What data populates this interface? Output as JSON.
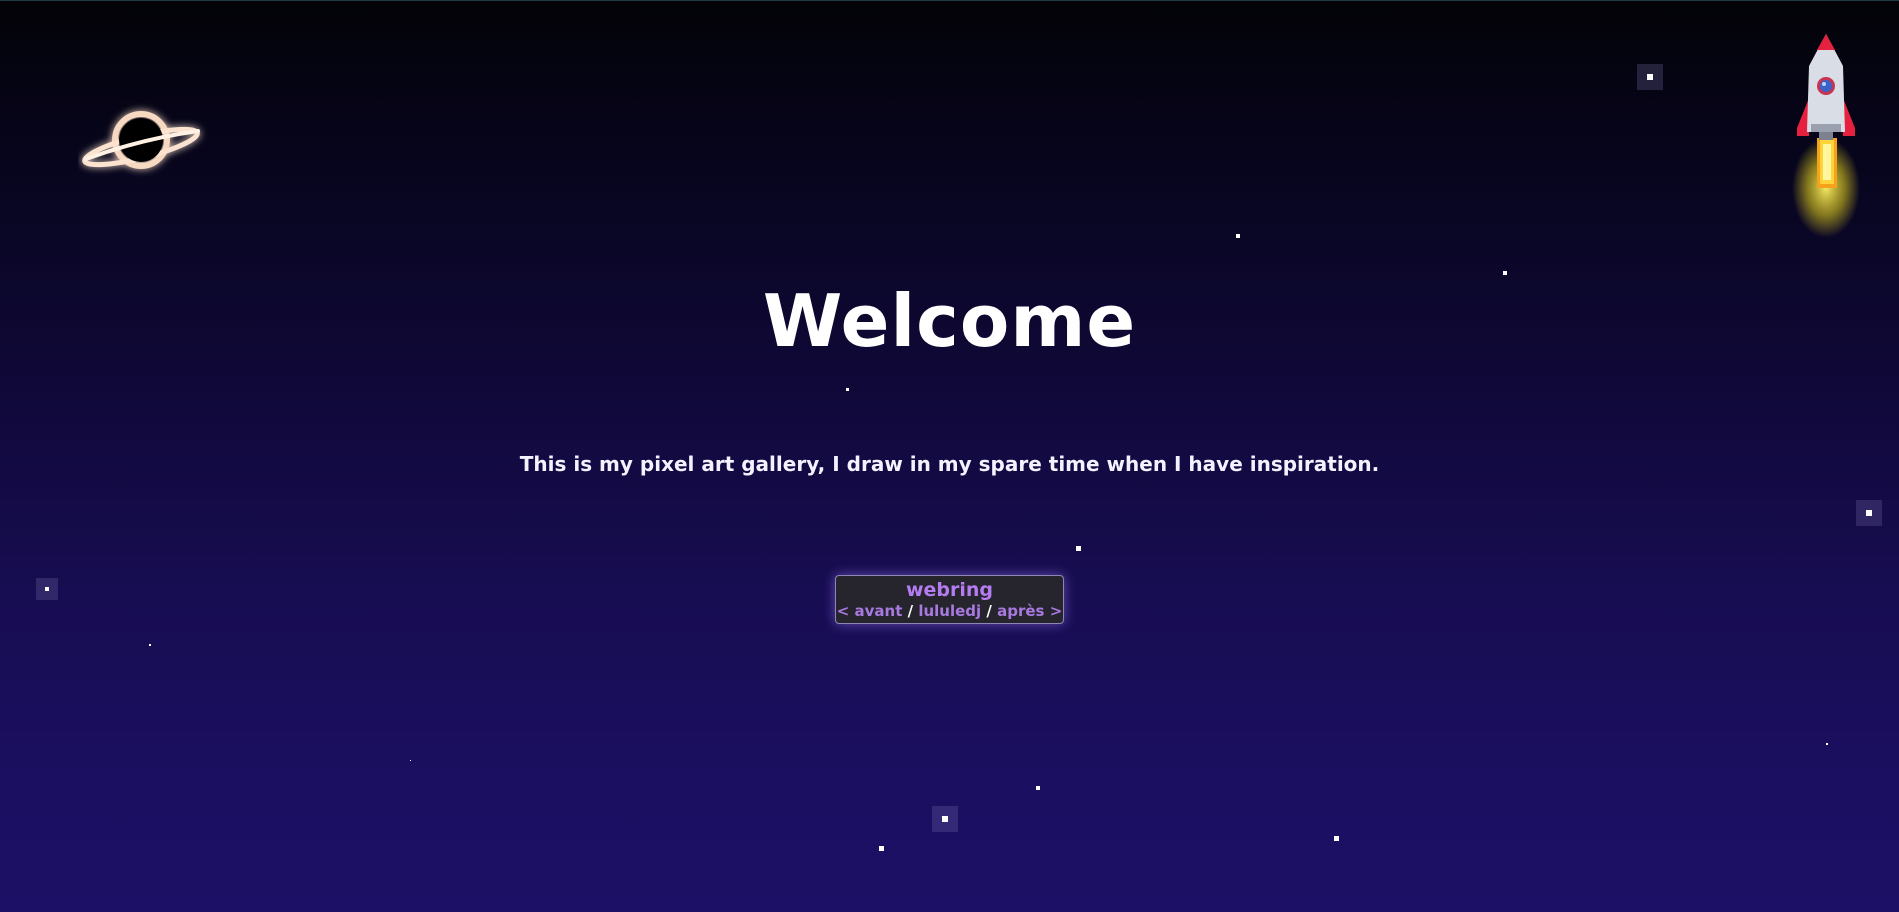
{
  "page": {
    "title": "Welcome",
    "tagline": "This is my pixel art gallery, I draw in my spare time when I have inspiration."
  },
  "webring": {
    "title": "webring",
    "prev": "< avant",
    "sep1": "/",
    "home": "lululedj",
    "sep2": "/",
    "next": "après >"
  },
  "decorations": {
    "planet": "black-hole-icon",
    "rocket": "pixel-rocket-icon"
  },
  "colors": {
    "background_top": "#030308",
    "background_bottom": "#1c1066",
    "accent": "#b57cf2",
    "webring_bg": "#26252d"
  }
}
